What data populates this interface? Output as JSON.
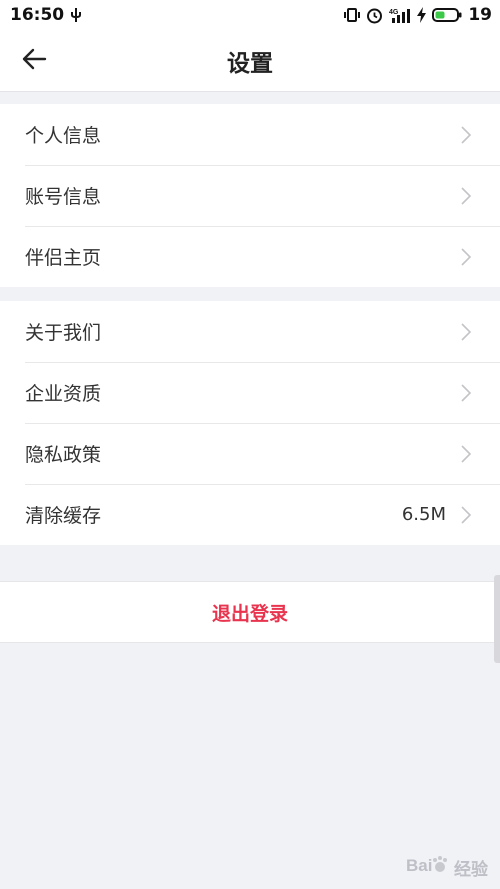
{
  "status_bar": {
    "time": "16:50",
    "battery": "19",
    "network": "4G",
    "icons": [
      "usb-icon",
      "vibrate-icon",
      "alarm-icon",
      "signal-icon",
      "charging-icon",
      "battery-icon"
    ]
  },
  "header": {
    "title": "设置",
    "back_icon": "back-arrow-icon"
  },
  "groups": [
    {
      "items": [
        {
          "label": "个人信息"
        },
        {
          "label": "账号信息"
        },
        {
          "label": "伴侣主页"
        }
      ]
    },
    {
      "items": [
        {
          "label": "关于我们"
        },
        {
          "label": "企业资质"
        },
        {
          "label": "隐私政策"
        },
        {
          "label": "清除缓存",
          "value": "6.5M"
        }
      ]
    }
  ],
  "logout": {
    "label": "退出登录"
  },
  "watermark": {
    "text": "经验"
  },
  "colors": {
    "background": "#f1f2f6",
    "surface": "#ffffff",
    "accent": "#e8344e",
    "chevron": "#c4c4c8",
    "battery_fill": "#3cc94a"
  }
}
